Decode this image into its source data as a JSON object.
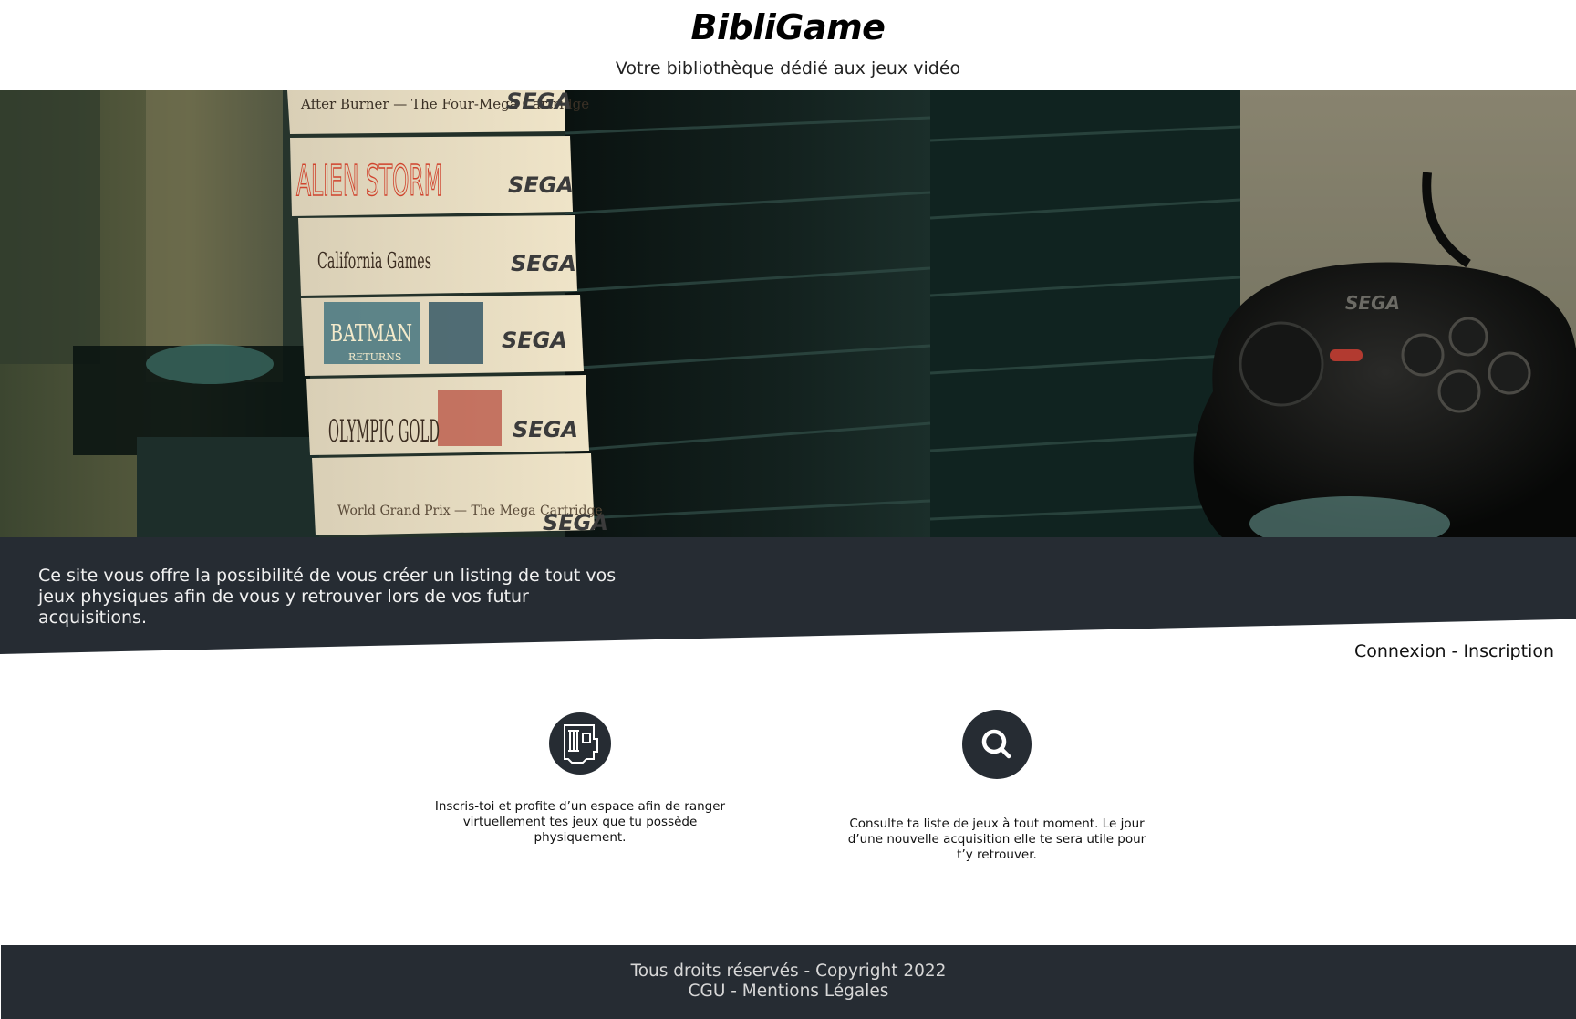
{
  "header": {
    "brand": "BibliGame",
    "tagline": "Votre bibliothèque dédié aux jeux vidéo"
  },
  "hero": {
    "image": "stack-of-sega-game-cases-and-controller",
    "case_labels": [
      "After Burner — The Four-Mega Cartridge",
      "ALIEN STORM",
      "California Games",
      "BATMAN RETURNS",
      "OLYMPIC GOLD",
      "World Grand Prix — The Mega Cartridge"
    ],
    "brand_mark": "SEGA"
  },
  "intro": {
    "text": "Ce site vous offre la possibilité de vous créer un listing de tout vos jeux physiques afin de vous y retrouver lors de vos futur acquisitions."
  },
  "auth": {
    "login": "Connexion",
    "separator": " - ",
    "signup": "Inscription"
  },
  "features": [
    {
      "icon": "game-cartridge-icon",
      "text": "Inscris-toi et profite d’un espace afin de ranger virtuellement tes jeux que tu possède physiquement."
    },
    {
      "icon": "search-icon",
      "text": "Consulte ta liste de jeux à tout moment. Le jour d’une nouvelle acquisition elle te sera utile pour t’y retrouver."
    }
  ],
  "footer": {
    "copyright": "Tous droits réservés - Copyright 2022",
    "cgu": "CGU",
    "separator": " - ",
    "legal": "Mentions Légales"
  },
  "colors": {
    "dark_band": "#262c33",
    "footer_text": "#d7d7d7"
  }
}
